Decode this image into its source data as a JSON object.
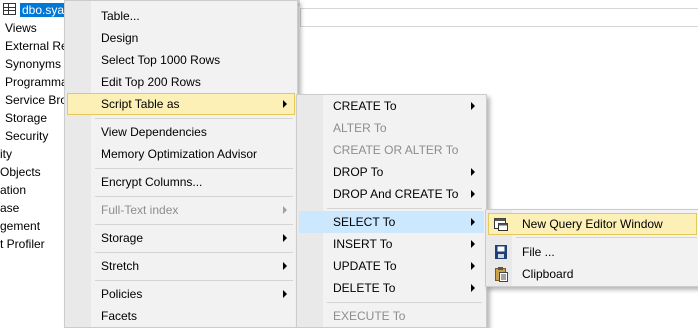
{
  "tree": {
    "selected": "dbo.sya",
    "items": [
      "Views",
      "External Re",
      "Synonyms",
      "Programma",
      "Service Bro",
      "Storage",
      "Security",
      "ity",
      "Objects",
      "ation",
      "ase",
      "gement",
      "t Profiler"
    ]
  },
  "menu1": {
    "table": "Table...",
    "design": "Design",
    "select_top": "Select Top 1000 Rows",
    "edit_top": "Edit Top 200 Rows",
    "script_table_as": "Script Table as",
    "view_dependencies": "View Dependencies",
    "memory_optimization": "Memory Optimization Advisor",
    "encrypt_columns": "Encrypt Columns...",
    "full_text_index": "Full-Text index",
    "storage": "Storage",
    "stretch": "Stretch",
    "policies": "Policies",
    "facets": "Facets"
  },
  "menu2": {
    "create_to": "CREATE To",
    "alter_to": "ALTER To",
    "create_or_alter_to": "CREATE OR ALTER To",
    "drop_to": "DROP To",
    "drop_and_create_to": "DROP And CREATE To",
    "select_to": "SELECT To",
    "insert_to": "INSERT To",
    "update_to": "UPDATE To",
    "delete_to": "DELETE To",
    "execute_to": "EXECUTE To"
  },
  "menu3": {
    "new_query_editor_window": "New Query Editor Window",
    "file": "File ...",
    "clipboard": "Clipboard"
  },
  "icons": [
    "table-icon",
    "new-query-window-icon",
    "save-file-icon",
    "clipboard-icon"
  ],
  "colors": {
    "hover": "#cce8ff",
    "active": "#fcf0b6",
    "selection": "#0078d7",
    "disabled": "#8d8d8d"
  }
}
